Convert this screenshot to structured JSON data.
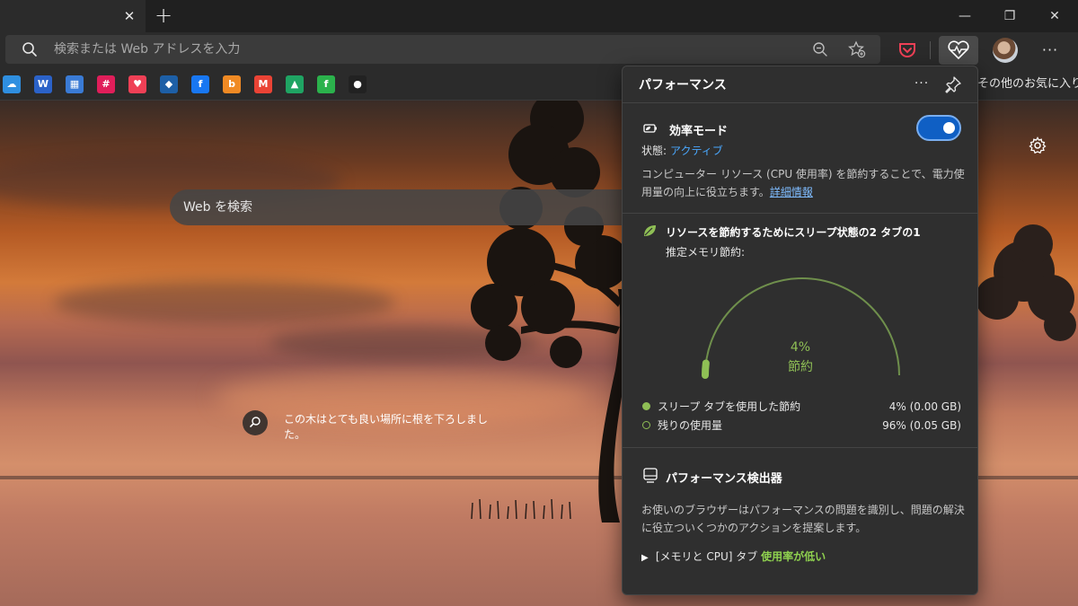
{
  "tabstrip": {
    "close_glyph": "✕",
    "new_tab_glyph": "+",
    "minimize_glyph": "—",
    "maximize_glyph": "❐",
    "close_window_glyph": "✕"
  },
  "address_bar": {
    "placeholder": "検索または Web アドレスを入力",
    "icons": [
      "search-icon",
      "zoom-out-icon",
      "add-favorite-icon"
    ]
  },
  "toolbar": {
    "icons": [
      "pocket-icon",
      "performance-heartbeat-icon",
      "profile-avatar",
      "more-icon"
    ],
    "more_glyph": "···"
  },
  "favorites_bar": {
    "items": [
      {
        "name": "onedrive",
        "glyph": "☁",
        "color": "#2f8fe0"
      },
      {
        "name": "word",
        "glyph": "W",
        "color": "#2b62c8"
      },
      {
        "name": "calendar",
        "glyph": "▦",
        "color": "#3a7bd5"
      },
      {
        "name": "slack",
        "glyph": "#",
        "color": "#e01e5a"
      },
      {
        "name": "pocket",
        "glyph": "♥",
        "color": "#ef4056"
      },
      {
        "name": "shield",
        "glyph": "◆",
        "color": "#1d5fa6"
      },
      {
        "name": "facebook",
        "glyph": "f",
        "color": "#1877f2"
      },
      {
        "name": "bing",
        "glyph": "b",
        "color": "#f08a24"
      },
      {
        "name": "gmail",
        "glyph": "M",
        "color": "#ea4335"
      },
      {
        "name": "drive",
        "glyph": "▲",
        "color": "#1fa463"
      },
      {
        "name": "feedly",
        "glyph": "f",
        "color": "#2bb24c"
      },
      {
        "name": "mic",
        "glyph": "●",
        "color": "#222222"
      }
    ],
    "other_favorites": "その他のお気に入り"
  },
  "ntp": {
    "search_placeholder": "Web を検索",
    "caption": "この木はとても良い場所に根を下ろしました。"
  },
  "performance": {
    "title": "パフォーマンス",
    "more_glyph": "···",
    "efficiency_mode": {
      "title": "効率モード",
      "enabled": true,
      "status_label": "状態:",
      "status_value": "アクティブ",
      "description": "コンピューター リソース (CPU 使用率) を節約することで、電力使用量の向上に役立ちます。",
      "link": "詳細情報"
    },
    "sleeping_tabs": {
      "title": "リソースを節約するためにスリープ状態の2 タブの1",
      "memory_label": "推定メモリ節約:",
      "saved_percent": 4,
      "gauge_percent_text": "4%",
      "gauge_label": "節約",
      "legend": [
        {
          "label": "スリープ タブを使用した節約",
          "value": "4% (0.00 GB)",
          "color": "#8fbf55",
          "filled": true
        },
        {
          "label": "残りの使用量",
          "value": "96% (0.05 GB)",
          "color": "#8fbf55",
          "filled": false
        }
      ]
    },
    "detector": {
      "title": "パフォーマンス検出器",
      "description": "お使いのブラウザーはパフォーマンスの問題を識別し、問題の解決に役立ついくつかのアクションを提案します。",
      "issue_arrow": "▶",
      "issue_prefix": "[メモリと CPU] タブ",
      "issue_highlight": "使用率が低い"
    }
  },
  "colors": {
    "accent_blue": "#0f5fc4",
    "link_blue": "#4aa8ff",
    "saving_green": "#8fbf55"
  }
}
